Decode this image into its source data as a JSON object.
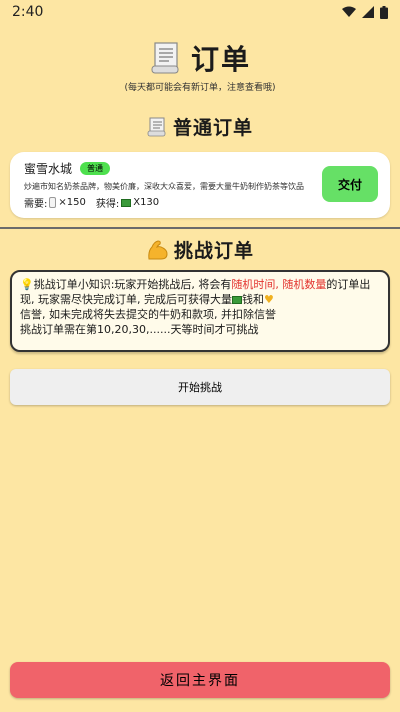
{
  "status": {
    "time": "2:40"
  },
  "header": {
    "title": "订单",
    "subtitle": "(每天都可能会有新订单，注意查看哦)"
  },
  "normal_section": {
    "title": "普通订单"
  },
  "order": {
    "name": "蜜雪水城",
    "badge": "普通",
    "desc": "炒遍市知名奶茶品牌，物美价廉，深收大众喜爱，需要大量牛奶制作奶茶等饮品",
    "need_label": "需要:",
    "need_qty": "×150",
    "reward_label": "获得:",
    "reward_qty": "X130",
    "submit_label": "交付"
  },
  "challenge_section": {
    "title": "挑战订单",
    "tip_part1": "挑战订单小知识:玩家开始挑战后, 将会有",
    "tip_red": "随机时间, 随机数量",
    "tip_part2": "的订单出现, 玩家需尽快完成订单, 完成后可获得大量",
    "tip_part3": "钱和",
    "tip_part4": "信誉, 如未完成将失去提交的牛奶和款项, 并扣除信誉",
    "tip_part5": "挑战订单需在第10,20,30,......天等时间才可挑战"
  },
  "start_button": {
    "label": "开始挑战"
  },
  "back_button": {
    "label": "返回主界面"
  }
}
